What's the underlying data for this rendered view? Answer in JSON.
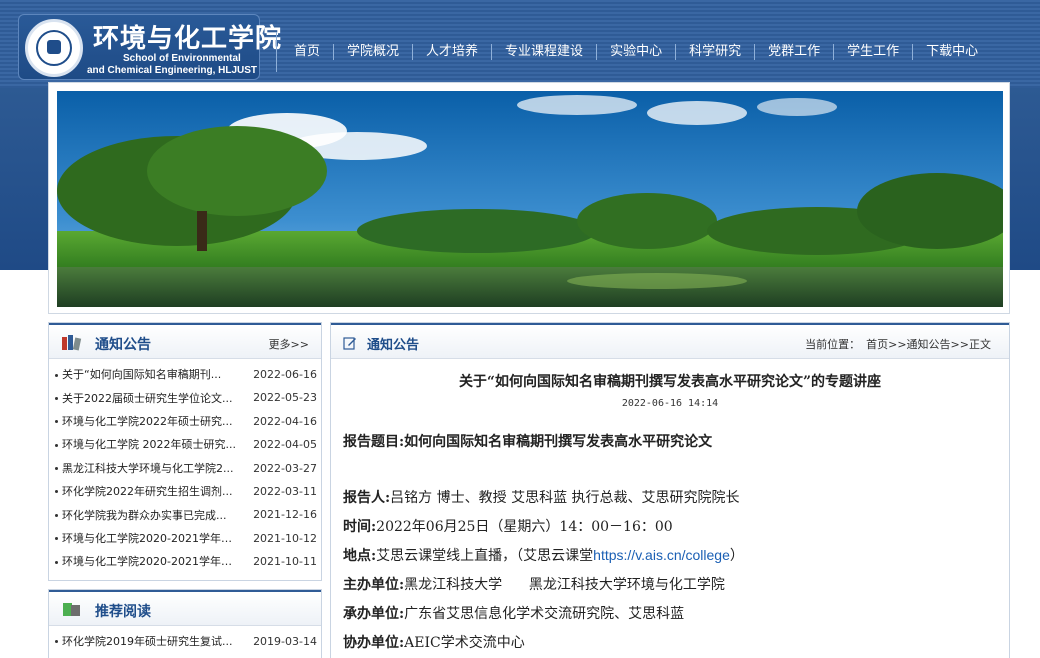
{
  "header": {
    "school_cn": "环境与化工学院",
    "school_en_line1": "School of Environmental",
    "school_en_line2": "and Chemical Engineering,  HLJUST",
    "nav": [
      "首页",
      "学院概况",
      "人才培养",
      "专业课程建设",
      "实验中心",
      "科学研究",
      "党群工作",
      "学生工作",
      "下载中心"
    ]
  },
  "sidebar": {
    "notice_title": "通知公告",
    "more_label": "更多>>",
    "notices": [
      {
        "title": "关于“如何向国际知名审稿期刊...",
        "date": "2022-06-16"
      },
      {
        "title": "关于2022届硕士研究生学位论文...",
        "date": "2022-05-23"
      },
      {
        "title": "环境与化工学院2022年硕士研究...",
        "date": "2022-04-16"
      },
      {
        "title": "环境与化工学院 2022年硕士研究...",
        "date": "2022-04-05"
      },
      {
        "title": "黑龙江科技大学环境与化工学院2...",
        "date": "2022-03-27"
      },
      {
        "title": "环化学院2022年研究生招生调剂...",
        "date": "2022-03-11"
      },
      {
        "title": "环化学院我为群众办实事已完成...",
        "date": "2021-12-16"
      },
      {
        "title": "环境与化工学院2020-2021学年国...",
        "date": "2021-10-12"
      },
      {
        "title": "环境与化工学院2020-2021学年国...",
        "date": "2021-10-11"
      }
    ],
    "recommend_title": "推荐阅读",
    "recommend": [
      {
        "title": "环化学院2019年硕士研究生复试...",
        "date": "2019-03-14"
      }
    ]
  },
  "main": {
    "section_title": "通知公告",
    "breadcrumb_label": "当前位置：",
    "breadcrumb_path": "首页>>通知公告>>正文",
    "article_title": "关于“如何向国际知名审稿期刊撰写发表高水平研究论文”的专题讲座",
    "article_date": "2022-06-16 14:14",
    "topic_label": "报告题目:",
    "topic_value": "如何向国际知名审稿期刊撰写发表高水平研究论文",
    "speaker_label": "报告人:",
    "speaker_value": "吕铭方 博士、教授  艾思科蓝  执行总裁、艾思研究院院长",
    "time_label": "时间:",
    "time_value": "2022年06月25日（星期六）14：00－16：00",
    "place_label": "地点:",
    "place_value": "艾思云课堂线上直播，（艾思云课堂",
    "place_link": "https://v.ais.cn/college",
    "place_end": "）",
    "host_label": "主办单位:",
    "host_value": "黑龙江科技大学      黑龙江科技大学环境与化工学院",
    "organizer_label": "承办单位:",
    "organizer_value": "广东省艾思信息化学术交流研究院、艾思科蓝",
    "co_label": "协办单位:",
    "co_value": "AEIC学术交流中心"
  },
  "colors": {
    "header_blue": "#2f5b96",
    "link_blue": "#1a5fb4",
    "title_blue": "#1f4d8a"
  }
}
